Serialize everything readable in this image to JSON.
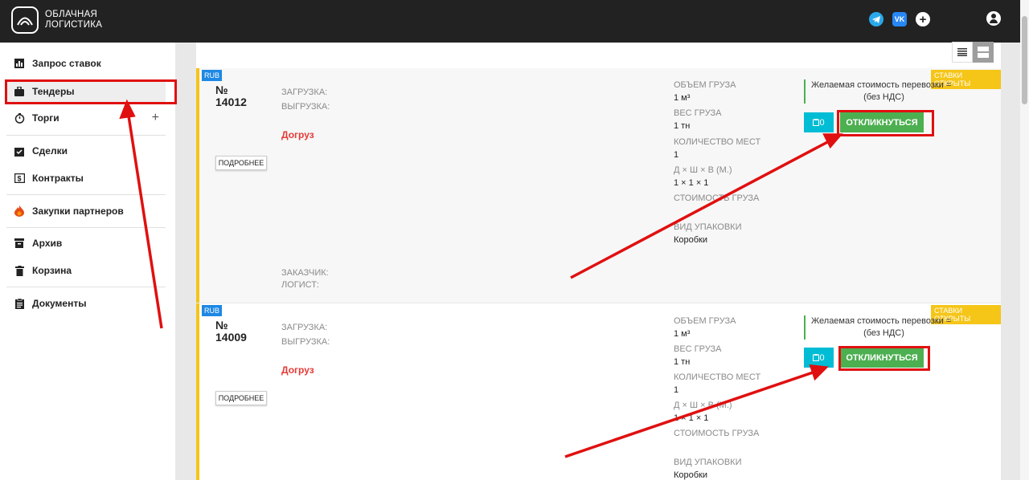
{
  "header": {
    "logo_line1": "ОБЛАЧНАЯ",
    "logo_line2": "ЛОГИСТИКА",
    "social": [
      "telegram-icon",
      "vk-icon",
      "plus-icon"
    ],
    "vk_label": "VK",
    "plus_label": "+"
  },
  "sidebar": {
    "items": [
      {
        "label": "Запрос ставок",
        "icon": "bar-chart-icon"
      },
      {
        "label": "Тендеры",
        "icon": "briefcase-icon"
      },
      {
        "label": "Торги",
        "icon": "timer-icon"
      },
      {
        "label": "Сделки",
        "icon": "clipboard-check-icon"
      },
      {
        "label": "Контракты",
        "icon": "dollar-doc-icon"
      },
      {
        "label": "Закупки партнеров",
        "icon": "fire-icon"
      },
      {
        "label": "Архив",
        "icon": "archive-icon"
      },
      {
        "label": "Корзина",
        "icon": "trash-icon"
      },
      {
        "label": "Документы",
        "icon": "document-icon"
      }
    ],
    "torgi_plus": "+"
  },
  "labels": {
    "rub": "RUB",
    "status": "СТАВКИ ОТКРЫТЫ",
    "more": "ПОДРОБНЕЕ",
    "loading": "ЗАГРУЗКА:",
    "unloading": "ВЫГРУЗКА:",
    "dogruz": "Догруз",
    "customer": "ЗАКАЗЧИК:",
    "logist": "ЛОГИСТ:",
    "volume": "ОБЪЕМ ГРУЗА",
    "weight": "ВЕС ГРУЗА",
    "places": "КОЛИЧЕСТВО МЕСТ",
    "dims": "Д × Ш × В (М.)",
    "cost": "СТОИМОСТЬ ГРУЗА",
    "pack": "ВИД УПАКОВКИ",
    "desired_line1": "Желаемая стоимость перевозки =",
    "desired_line2": "(без НДС)",
    "respond": "ОТКЛИКНУТЬСЯ"
  },
  "tenders": [
    {
      "number_prefix": "№",
      "number": "14012",
      "volume": "1 м³",
      "weight": "1 тн",
      "places": "1",
      "dims": "1 × 1 × 1",
      "pack": "Коробки",
      "responses": "0"
    },
    {
      "number_prefix": "№",
      "number": "14009",
      "volume": "1 м³",
      "weight": "1 тн",
      "places": "1",
      "dims": "1 × 1 × 1",
      "pack": "Коробки",
      "responses": "0"
    }
  ],
  "colors": {
    "header_bg": "#222222",
    "accent_yellow": "#f5c518",
    "respond_green": "#4caf50",
    "count_cyan": "#00bcd4",
    "annotation_red": "#e01010"
  }
}
